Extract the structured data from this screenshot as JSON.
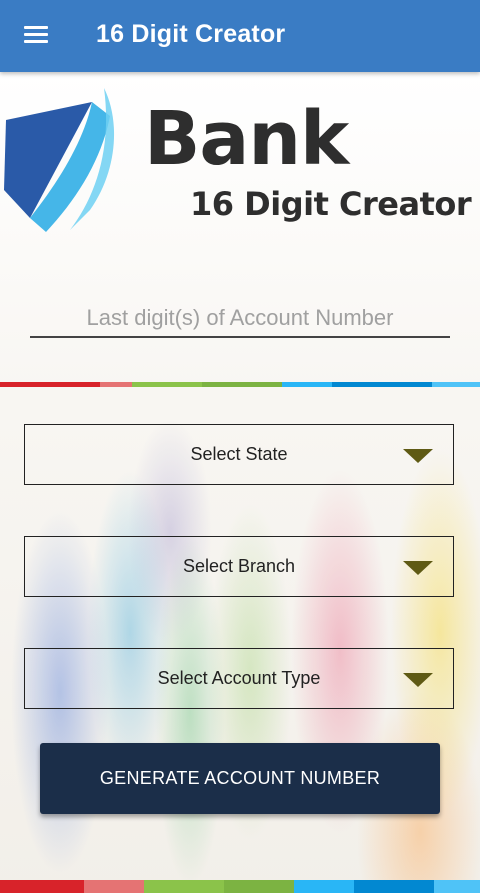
{
  "app_bar": {
    "title": "16 Digit Creator",
    "menu_icon": "hamburger-menu-icon",
    "background": "#3a7cc4"
  },
  "logo": {
    "brand": "Bank",
    "subtitle": "16 Digit Creator",
    "mark_colors": [
      "#2a5aa8",
      "#45b6e8"
    ]
  },
  "account_input": {
    "value": "",
    "placeholder": "Last digit(s) of Account Number"
  },
  "stripe_colors": [
    "#d8232a",
    "#e57373",
    "#8bc34a",
    "#7cb342",
    "#29b6f6",
    "#0288d1",
    "#4fc3f7"
  ],
  "selects": {
    "state": {
      "label": "Select State",
      "icon": "dropdown-arrow-icon"
    },
    "branch": {
      "label": "Select Branch",
      "icon": "dropdown-arrow-icon"
    },
    "account_type": {
      "label": "Select Account Type",
      "icon": "dropdown-arrow-icon"
    }
  },
  "generate_button": {
    "label": "GENERATE ACCOUNT NUMBER",
    "background": "#1b2e49"
  }
}
